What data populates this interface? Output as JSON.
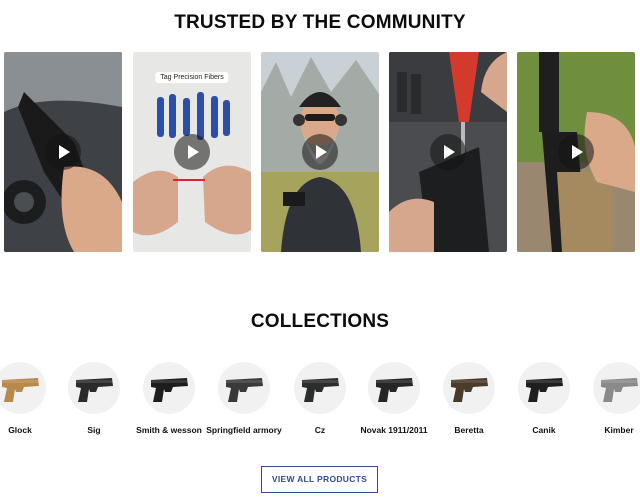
{
  "community": {
    "title": "TRUSTED BY THE COMMUNITY",
    "videos": [
      {
        "id": "v1",
        "overlay_text": ""
      },
      {
        "id": "v2",
        "overlay_text": "Tag Precision Fibers"
      },
      {
        "id": "v3",
        "overlay_text": ""
      },
      {
        "id": "v4",
        "overlay_text": ""
      },
      {
        "id": "v5",
        "overlay_text": ""
      }
    ],
    "play_icon": "play-icon"
  },
  "collections": {
    "title": "COLLECTIONS",
    "items": [
      {
        "label": "Glock",
        "frame_color": "#b58a4a"
      },
      {
        "label": "Sig",
        "frame_color": "#2b2b2b"
      },
      {
        "label": "Smith & wesson",
        "frame_color": "#1d1d1d"
      },
      {
        "label": "Springfield armory",
        "frame_color": "#3a3a3a"
      },
      {
        "label": "Cz",
        "frame_color": "#2a2e2c"
      },
      {
        "label": "Novak 1911/2011",
        "frame_color": "#262626"
      },
      {
        "label": "Beretta",
        "frame_color": "#4a3a2a"
      },
      {
        "label": "Canik",
        "frame_color": "#1f1f1f"
      },
      {
        "label": "Kimber",
        "frame_color": "#8a8a8a"
      }
    ],
    "view_all_label": "VIEW ALL PRODUCTS"
  },
  "colors": {
    "button_border": "#2f4d92",
    "title_text": "#0c0c0c"
  }
}
